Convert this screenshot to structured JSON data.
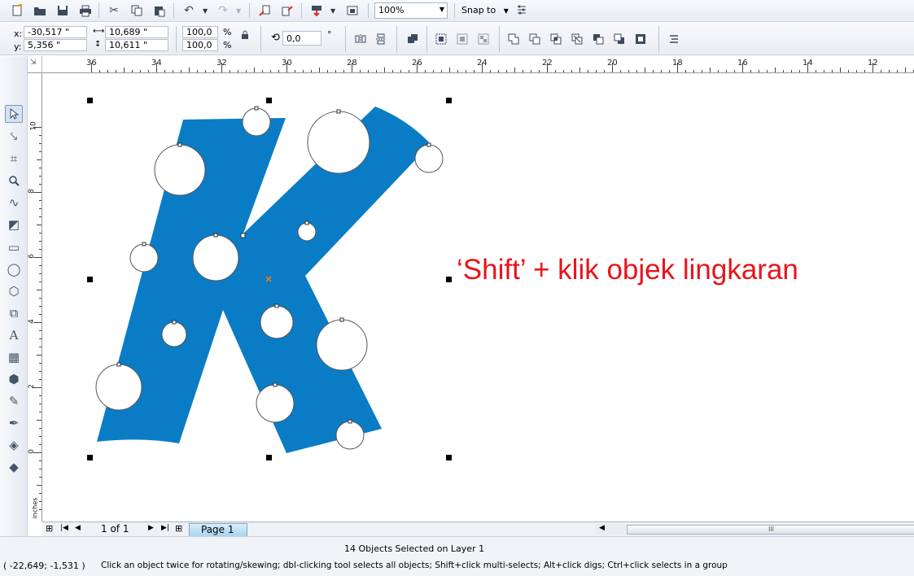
{
  "toolbar": {
    "zoom_value": "100%",
    "snap_label": "Snap to",
    "icons": [
      "new-icon",
      "open-icon",
      "save-icon",
      "print-icon",
      "cut-icon",
      "copy-icon",
      "paste-icon",
      "undo-icon",
      "redo-icon",
      "import-icon",
      "export-icon",
      "publish-icon",
      "app-launcher-icon",
      "options-icon"
    ]
  },
  "property_bar": {
    "x_label": "x:",
    "x_value": "-30,517 \"",
    "y_label": "y:",
    "y_value": "5,356 \"",
    "width_value": "10,689 \"",
    "height_value": "10,611 \"",
    "scale_x": "100,0",
    "scale_y": "100,0",
    "percent_x": "%",
    "percent_y": "%",
    "rotation_value": "0,0",
    "degree_symbol": "°"
  },
  "ruler": {
    "h_labels": [
      "36",
      "34",
      "32",
      "30",
      "28",
      "26",
      "24",
      "22",
      "20",
      "18",
      "16",
      "14",
      "12"
    ],
    "v_labels": [
      "10",
      "8",
      "6",
      "4",
      "2",
      "0"
    ],
    "units": "inches"
  },
  "canvas": {
    "shape_color": "#0a7cc6",
    "annotation_text": "‘Shift’ + klik objek lingkaran",
    "annotation_color": "#e8141b"
  },
  "navigator": {
    "page_count": "1 of 1",
    "page_tab": "Page 1"
  },
  "status": {
    "selection_info": "14 Objects Selected on Layer 1",
    "cursor_coords": "( -22,649; -1,531 )",
    "hint_text": "Click an object twice for rotating/skewing; dbl-clicking tool selects all objects; Shift+click multi-selects; Alt+click digs; Ctrl+click selects in a group"
  }
}
